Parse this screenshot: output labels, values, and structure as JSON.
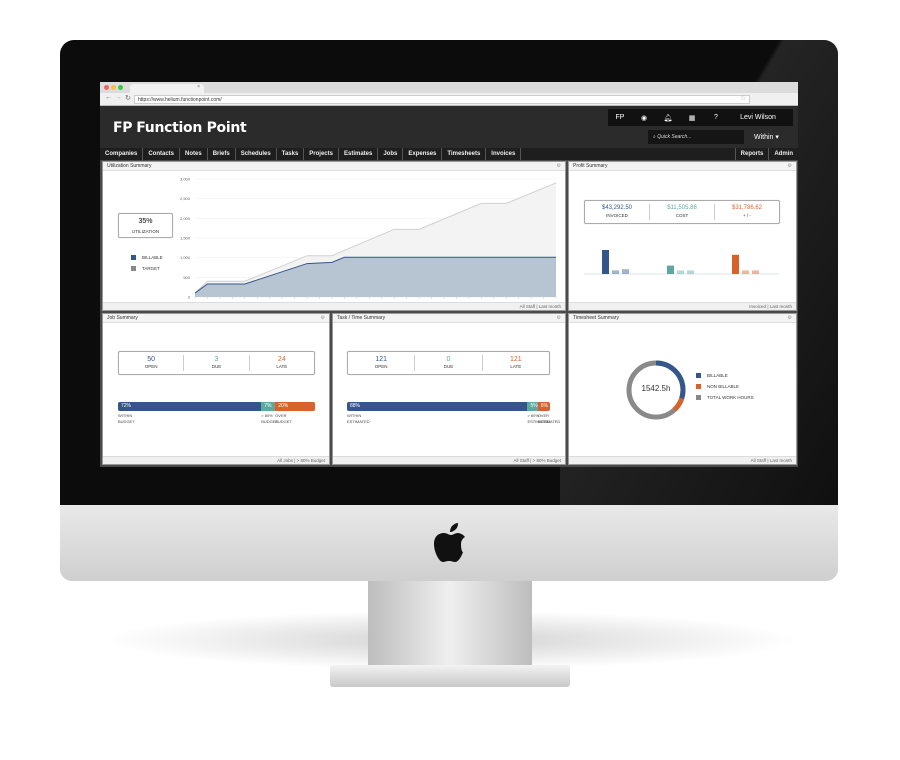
{
  "browser": {
    "url": "https://www.helium.functionpoint.com/",
    "tab_close": "×"
  },
  "app": {
    "logo_mark": "FP",
    "title": "Function Point",
    "user": "Levi Wilson",
    "search_placeholder": "Quick Search...",
    "within": "Within",
    "help": "?"
  },
  "nav": {
    "items": [
      "Companies",
      "Contacts",
      "Notes",
      "Briefs",
      "Schedules",
      "Tasks",
      "Projects",
      "Estimates",
      "Jobs",
      "Expenses",
      "Timesheets",
      "Invoices"
    ],
    "right": [
      "Reports",
      "Admin"
    ]
  },
  "colors": {
    "blue": "#34568b",
    "teal": "#5fa8a0",
    "orange": "#d9622b",
    "gray": "#888888"
  },
  "utilization": {
    "title": "Utilization Summary",
    "value": "35%",
    "label": "UTILIZATION",
    "legend": [
      "BILLABLE",
      "TARGET"
    ],
    "footer": [
      "All Staff",
      "Last month"
    ]
  },
  "chart_data": {
    "type": "area",
    "yticks": [
      "3,000",
      "2,500",
      "2,000",
      "1,500",
      "1,000",
      "500",
      "0"
    ],
    "ylim": [
      0,
      3000
    ],
    "series": [
      {
        "name": "TARGET",
        "points": [
          [
            0,
            100
          ],
          [
            1,
            400
          ],
          [
            4,
            400
          ],
          [
            9,
            1050
          ],
          [
            11,
            1050
          ],
          [
            16,
            1720
          ],
          [
            18,
            1720
          ],
          [
            23,
            2380
          ],
          [
            25,
            2380
          ],
          [
            29,
            2900
          ]
        ]
      },
      {
        "name": "BILLABLE",
        "points": [
          [
            0,
            100
          ],
          [
            1,
            330
          ],
          [
            4,
            330
          ],
          [
            9,
            850
          ],
          [
            11,
            880
          ],
          [
            12,
            1010
          ],
          [
            29,
            1010
          ]
        ]
      }
    ]
  },
  "profit": {
    "title": "Profit Summary",
    "invoiced": "$43,292.50",
    "invoiced_label": "INVOICED",
    "cost": "$11,505.88",
    "cost_label": "COST",
    "diff": "$31,786.62",
    "diff_label": "+ / -",
    "bars": [
      [
        1,
        0.15,
        0.2
      ],
      [
        0.35,
        0.15,
        0.15
      ],
      [
        0.8,
        0.15,
        0.15
      ]
    ],
    "footer": [
      "Invoiced",
      "Last month"
    ]
  },
  "jobs": {
    "title": "Job Summary",
    "open": "50",
    "open_label": "OPEN",
    "due": "3",
    "due_label": "DUE",
    "late": "24",
    "late_label": "LATE",
    "bar": [
      {
        "pct": "72%",
        "value": 72,
        "label1": "WITHIN",
        "label2": "BUDGET"
      },
      {
        "pct": "7%",
        "value": 7,
        "label1": "> 80%",
        "label2": "BUDGET"
      },
      {
        "pct": "20%",
        "value": 20,
        "label1": "OVER",
        "label2": "BUDGET"
      }
    ],
    "footer": [
      "All Jobs",
      "> 80% Budget"
    ]
  },
  "tasks": {
    "title": "Task / Time Summary",
    "open": "121",
    "open_label": "OPEN",
    "due": "0",
    "due_label": "DUE",
    "late": "121",
    "late_label": "LATE",
    "bar": [
      {
        "pct": "88%",
        "value": 88,
        "label1": "WITHIN",
        "label2": "ESTIMATED"
      },
      {
        "pct": "5%",
        "value": 5,
        "label1": "> 80%",
        "label2": "ESTIMATED"
      },
      {
        "pct": "6%",
        "value": 6,
        "label1": "OVER",
        "label2": "ESTIMATED"
      }
    ],
    "footer": [
      "All Staff",
      "> 80% Budget"
    ]
  },
  "timesheet": {
    "title": "Timesheet Summary",
    "total": "1542.5h",
    "billable_fraction": 0.3,
    "nonbillable_fraction": 0.08,
    "legend": [
      "BILLABLE",
      "NON BILLABLE",
      "TOTAL WORK HOURS"
    ],
    "footer": [
      "All Staff",
      "Last month"
    ]
  }
}
